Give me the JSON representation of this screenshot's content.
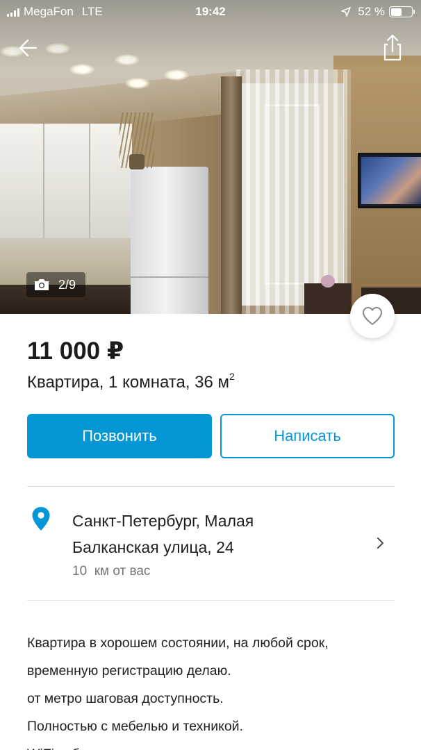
{
  "status_bar": {
    "carrier": "MegaFon",
    "network": "LTE",
    "time": "19:42",
    "battery_percent": "52 %",
    "battery_level": 0.52
  },
  "header": {
    "back_icon": "arrow-left-icon",
    "share_icon": "share-icon"
  },
  "gallery": {
    "counter": "2/9",
    "current_index": 2,
    "total": 9,
    "counter_icon": "camera-icon",
    "favorite_icon": "heart-outline-icon"
  },
  "listing": {
    "price": "11 000 ₽",
    "subtitle": "Квартира, 1 комната, 36 м",
    "subtitle_sup": "2"
  },
  "actions": {
    "call_label": "Позвонить",
    "message_label": "Написать"
  },
  "location": {
    "address_line1": "Санкт-Петербург, Малая",
    "address_line2": "Балканская улица, 24",
    "distance": "10  км от вас",
    "icon": "map-pin-icon"
  },
  "description": {
    "lines": [
      "Квартира в хорошем состоянии, на любой срок,",
      "временную регистрацию делаю.",
      "от метро шаговая доступность.",
      "Полностью с мебелью и техникой.",
      "WiFi кабельное тв есть"
    ]
  },
  "colors": {
    "accent": "#0596d6",
    "text": "#1f1f1f",
    "muted": "#757575",
    "divider": "#e2e2e2"
  }
}
